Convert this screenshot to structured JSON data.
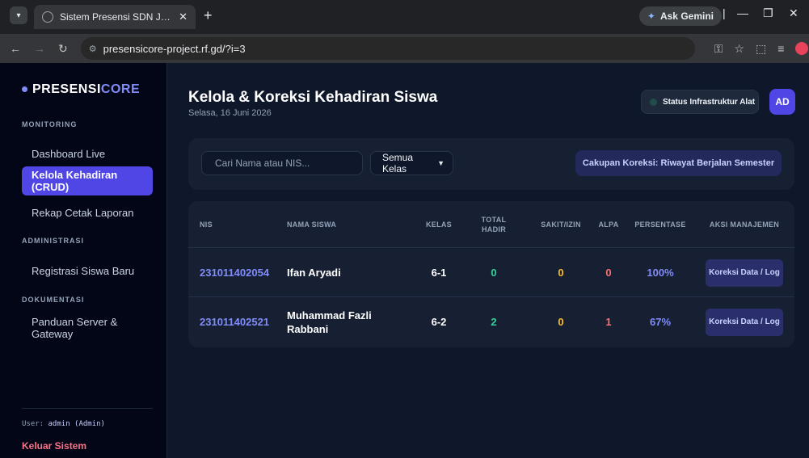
{
  "browser": {
    "tab_title": "Sistem Presensi SDN Jurang Ma",
    "new_tab": "+",
    "url": "presensicore-project.rf.gd/?i=3",
    "gemini_label": "Ask Gemini"
  },
  "sidebar": {
    "brand_part1": "PRESENSI",
    "brand_part2": "CORE",
    "sections": {
      "monitoring": "MONITORING",
      "administrasi": "ADMINISTRASI",
      "dokumentasi": "DOKUMENTASI"
    },
    "items": {
      "dashboard": "Dashboard Live",
      "kelola": "Kelola Kehadiran (CRUD)",
      "rekap": "Rekap Cetak Laporan",
      "registrasi": "Registrasi Siswa Baru",
      "panduan": "Panduan Server & Gateway"
    },
    "user_prefix": "User:",
    "user_name": "admin (Admin)",
    "logout": "Keluar Sistem"
  },
  "header": {
    "title": "Kelola & Koreksi Kehadiran Siswa",
    "date": "Selasa, 16 Juni 2026",
    "status_button": "Status Infrastruktur Alat",
    "avatar_initials": "AD"
  },
  "filters": {
    "search_placeholder": "Cari Nama atau NIS...",
    "class_selected": "Semua Kelas",
    "scope_label": "Cakupan Koreksi: Riwayat Berjalan Semester"
  },
  "table": {
    "columns": {
      "nis": "NIS",
      "nama": "NAMA SISWA",
      "kelas": "KELAS",
      "total_hadir_1": "TOTAL",
      "total_hadir_2": "HADIR",
      "sakit": "SAKIT/IZIN",
      "alpa": "ALPA",
      "persentase": "PERSENTASE",
      "aksi": "AKSI MANAJEMEN"
    },
    "rows": [
      {
        "nis": "231011402054",
        "nama": "Ifan Aryadi",
        "kelas": "6-1",
        "hadir": "0",
        "sakit": "0",
        "alpa": "0",
        "persentase": "100%",
        "aksi": "Koreksi Data / Log"
      },
      {
        "nis": "231011402521",
        "nama": "Muhammad Fazli Rabbani",
        "kelas": "6-2",
        "hadir": "2",
        "sakit": "0",
        "alpa": "1",
        "persentase": "67%",
        "aksi": "Koreksi Data / Log"
      }
    ]
  }
}
